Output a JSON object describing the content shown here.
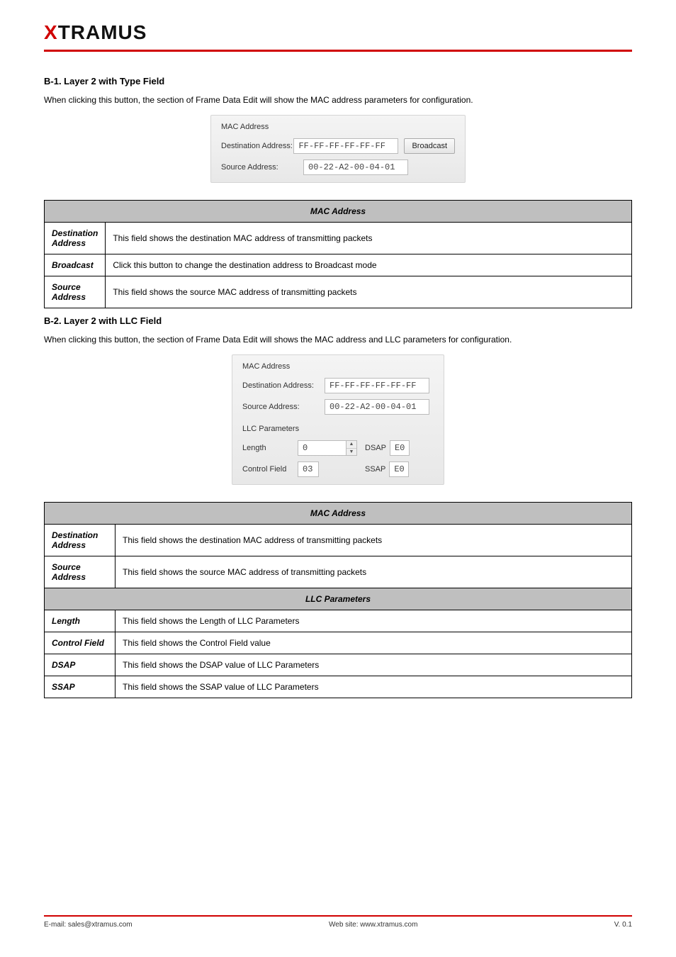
{
  "logo": {
    "x": "X",
    "rest": "TRAMUS"
  },
  "h1": "B-1. Layer 2 with Type Field",
  "intro1": "When clicking this button, the section of Frame Data Edit will show the MAC address parameters for configuration.",
  "panel1": {
    "title": "MAC Address",
    "destLabel": "Destination Address:",
    "destValue": "FF-FF-FF-FF-FF-FF",
    "broadcastLabel": "Broadcast",
    "srcLabel": "Source Address:",
    "srcValue": "00-22-A2-00-04-01"
  },
  "table1": {
    "header": "MAC Address",
    "rows": [
      {
        "label": "Destination Address",
        "desc": "This field shows the destination MAC address of transmitting packets"
      },
      {
        "label": "Broadcast",
        "desc": "Click this button to change the destination address to Broadcast mode"
      },
      {
        "label": "Source Address",
        "desc": "This field shows the source MAC address of transmitting packets"
      }
    ]
  },
  "h2": "B-2. Layer 2 with LLC Field",
  "intro2": "When clicking this button, the section of Frame Data Edit will shows the MAC address and LLC parameters for configuration.",
  "panel2": {
    "title1": "MAC Address",
    "destLabel": "Destination Address:",
    "destValue": "FF-FF-FF-FF-FF-FF",
    "srcLabel": "Source Address:",
    "srcValue": "00-22-A2-00-04-01",
    "title2": "LLC Parameters",
    "lengthLabel": "Length",
    "lengthValue": "0",
    "dsapLabel": "DSAP",
    "dsapValue": "E0",
    "ctrlLabel": "Control Field",
    "ctrlValue": "03",
    "ssapLabel": "SSAP",
    "ssapValue": "E0"
  },
  "table2": {
    "header1": "MAC Address",
    "rows1": [
      {
        "label": "Destination Address",
        "desc": "This field shows the destination MAC address of transmitting packets"
      },
      {
        "label": "Source Address",
        "desc": "This field shows the source MAC address of transmitting packets"
      }
    ],
    "header2": "LLC Parameters",
    "rows2": [
      {
        "label": "Length",
        "desc": "This field shows the Length of LLC Parameters"
      },
      {
        "label": "Control Field",
        "desc": "This field shows the Control Field value"
      },
      {
        "label": "DSAP",
        "desc": "This field shows the DSAP value of LLC Parameters"
      },
      {
        "label": "SSAP",
        "desc": "This field shows the SSAP value of LLC Parameters"
      }
    ]
  },
  "footer": {
    "left": "E-mail: sales@xtramus.com",
    "center": "Web site: www.xtramus.com",
    "right": "V. 0.1"
  }
}
